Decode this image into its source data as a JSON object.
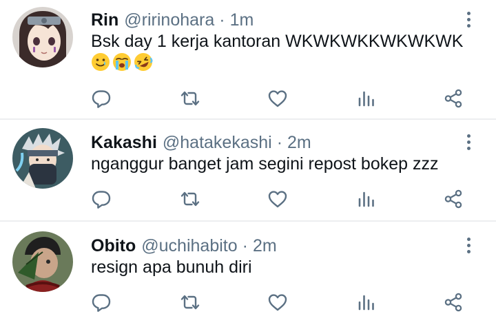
{
  "tweets": [
    {
      "name": "Rin",
      "handle": "@ririnohara",
      "separator": "·",
      "time": "1m",
      "text": "Bsk day 1 kerja kantoran WKWKWKKWKWKWK",
      "emojis": [
        "smiling-face-with-tear",
        "loudly-crying-face",
        "rolling-on-the-floor-laughing"
      ]
    },
    {
      "name": "Kakashi",
      "handle": "@hatakekashi",
      "separator": "·",
      "time": "2m",
      "text": "nganggur banget jam segini repost bokep zzz"
    },
    {
      "name": "Obito",
      "handle": "@uchihabito",
      "separator": "·",
      "time": "2m",
      "text": "resign apa bunuh diri"
    }
  ],
  "actions": [
    "reply-icon",
    "retweet-icon",
    "like-icon",
    "stats-icon",
    "share-icon"
  ],
  "colors": {
    "text": "#0f1419",
    "muted": "#5b7083",
    "divider": "#eceef0",
    "emoji": "#ffcc33"
  }
}
